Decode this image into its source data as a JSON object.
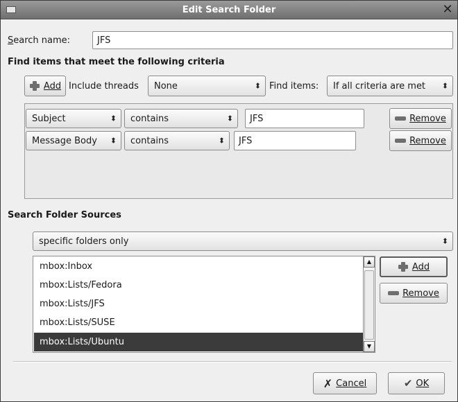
{
  "window": {
    "title": "Edit Search Folder"
  },
  "search_name": {
    "label": "Search name:",
    "value": "JFS"
  },
  "criteria_section": {
    "heading": "Find items that meet the following criteria",
    "add_label": "Add",
    "include_threads_label": "Include threads",
    "include_threads_value": "None",
    "find_items_label": "Find items:",
    "find_items_value": "If all criteria are met"
  },
  "rules": [
    {
      "field": "Subject",
      "operator": "contains",
      "value": "JFS",
      "remove_label": "Remove"
    },
    {
      "field": "Message Body",
      "operator": "contains",
      "value": "JFS",
      "remove_label": "Remove"
    }
  ],
  "sources_section": {
    "heading": "Search Folder Sources",
    "scope_value": "specific folders only",
    "folders": [
      "mbox:Inbox",
      "mbox:Lists/Fedora",
      "mbox:Lists/JFS",
      "mbox:Lists/SUSE",
      "mbox:Lists/Ubuntu"
    ],
    "selected_folder": "mbox:Lists/Ubuntu",
    "add_label": "Add",
    "remove_label": "Remove"
  },
  "footer": {
    "cancel_label": "Cancel",
    "ok_label": "OK"
  },
  "icons": {
    "add": "plus-icon",
    "remove": "minus-icon",
    "cancel": "x-icon",
    "ok": "check-icon",
    "close": "close-icon",
    "combo": "up-down-arrows-icon"
  },
  "colors": {
    "selection": "#3b3b3b",
    "titlebar": "#808080",
    "dialog": "#efefef"
  }
}
